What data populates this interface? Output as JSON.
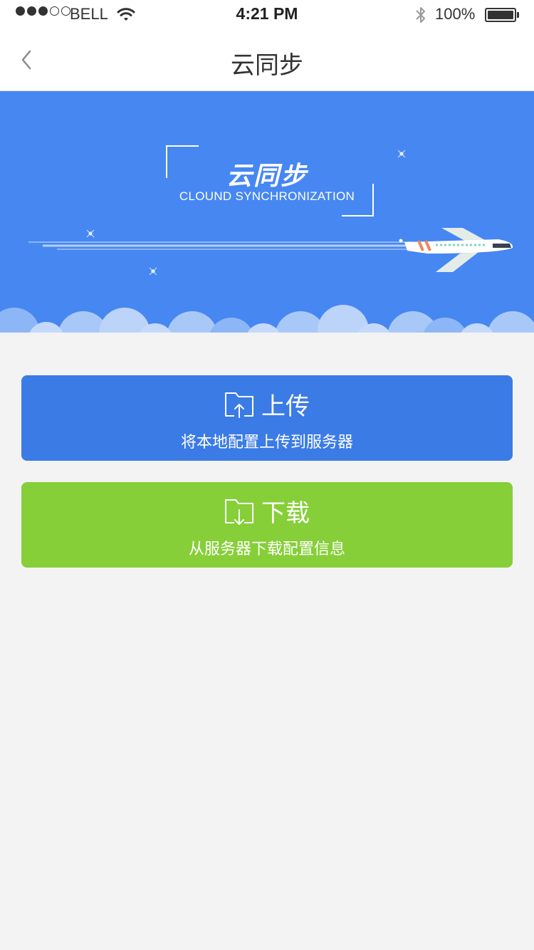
{
  "status_bar": {
    "carrier": "BELL",
    "time": "4:21 PM",
    "battery": "100%",
    "signal_bars_filled": 3,
    "signal_bars_total": 5
  },
  "nav": {
    "title": "云同步",
    "back_icon": "chevron-left-icon"
  },
  "banner": {
    "title": "云同步",
    "subtitle": "CLOUND SYNCHRONIZATION",
    "background": "#4687f2"
  },
  "actions": {
    "upload": {
      "title": "上传",
      "description": "将本地配置上传到服务器",
      "icon": "folder-upload-icon",
      "color": "#3b7be6"
    },
    "download": {
      "title": "下载",
      "description": "从服务器下载配置信息",
      "icon": "folder-download-icon",
      "color": "#86cf38"
    }
  }
}
